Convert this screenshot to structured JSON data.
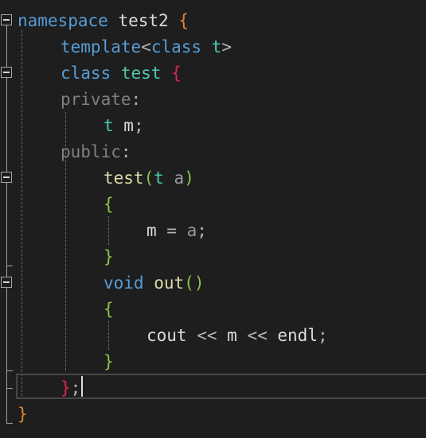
{
  "editor": {
    "theme": {
      "background": "#1e1e1e",
      "keyword": "#569cd6",
      "type": "#4ec9b0",
      "function": "#dcdcaa",
      "text": "#dcdcdc",
      "access": "#9b9b9b",
      "param": "#9cdcfe",
      "brace_orange": "#ffd700",
      "brace_pink": "#da70d6",
      "brace_green": "#6a9955",
      "punct": "#b4b4b4"
    },
    "lines": [
      {
        "indent": 0,
        "tokens": [
          {
            "t": "namespace",
            "c": "#569cd6"
          },
          {
            "t": " test2 ",
            "c": "#dcdcdc"
          },
          {
            "t": "{",
            "c": "#e2872e"
          }
        ]
      },
      {
        "indent": 4,
        "tokens": [
          {
            "t": "template",
            "c": "#569cd6"
          },
          {
            "t": "<",
            "c": "#b4b4b4"
          },
          {
            "t": "class",
            "c": "#569cd6"
          },
          {
            "t": " ",
            "c": "#dcdcdc"
          },
          {
            "t": "t",
            "c": "#4ec9b0"
          },
          {
            "t": ">",
            "c": "#b4b4b4"
          }
        ]
      },
      {
        "indent": 4,
        "tokens": [
          {
            "t": "class",
            "c": "#569cd6"
          },
          {
            "t": " ",
            "c": "#dcdcdc"
          },
          {
            "t": "test",
            "c": "#4ec9b0"
          },
          {
            "t": " ",
            "c": "#dcdcdc"
          },
          {
            "t": "{",
            "c": "#d9294f"
          }
        ]
      },
      {
        "indent": 4,
        "tokens": [
          {
            "t": "private",
            "c": "#808080"
          },
          {
            "t": ":",
            "c": "#b4b4b4"
          }
        ]
      },
      {
        "indent": 8,
        "tokens": [
          {
            "t": "t",
            "c": "#4ec9b0"
          },
          {
            "t": " m",
            "c": "#dcdcdc"
          },
          {
            "t": ";",
            "c": "#b4b4b4"
          }
        ]
      },
      {
        "indent": 4,
        "tokens": [
          {
            "t": "public",
            "c": "#808080"
          },
          {
            "t": ":",
            "c": "#b4b4b4"
          }
        ]
      },
      {
        "indent": 8,
        "tokens": [
          {
            "t": "test",
            "c": "#dcdcaa"
          },
          {
            "t": "(",
            "c": "#8bc34a"
          },
          {
            "t": "t",
            "c": "#4ec9b0"
          },
          {
            "t": " a",
            "c": "#9a9a9a"
          },
          {
            "t": ")",
            "c": "#8bc34a"
          }
        ]
      },
      {
        "indent": 8,
        "tokens": [
          {
            "t": "{",
            "c": "#8bc34a"
          }
        ]
      },
      {
        "indent": 12,
        "tokens": [
          {
            "t": "m",
            "c": "#dcdcdc"
          },
          {
            "t": " = ",
            "c": "#b4b4b4"
          },
          {
            "t": "a",
            "c": "#9a9a9a"
          },
          {
            "t": ";",
            "c": "#b4b4b4"
          }
        ]
      },
      {
        "indent": 8,
        "tokens": [
          {
            "t": "}",
            "c": "#8bc34a"
          }
        ]
      },
      {
        "indent": 8,
        "tokens": [
          {
            "t": "void",
            "c": "#569cd6"
          },
          {
            "t": " ",
            "c": "#dcdcdc"
          },
          {
            "t": "out",
            "c": "#dcdcaa"
          },
          {
            "t": "()",
            "c": "#8bc34a"
          }
        ]
      },
      {
        "indent": 8,
        "tokens": [
          {
            "t": "{",
            "c": "#8bc34a"
          }
        ]
      },
      {
        "indent": 12,
        "tokens": [
          {
            "t": "cout",
            "c": "#dcdcdc"
          },
          {
            "t": " << ",
            "c": "#b4b4b4"
          },
          {
            "t": "m",
            "c": "#dcdcdc"
          },
          {
            "t": " << ",
            "c": "#b4b4b4"
          },
          {
            "t": "endl",
            "c": "#dcdcdc"
          },
          {
            "t": ";",
            "c": "#b4b4b4"
          }
        ]
      },
      {
        "indent": 8,
        "tokens": [
          {
            "t": "}",
            "c": "#8bc34a"
          }
        ]
      },
      {
        "indent": 4,
        "tokens": [
          {
            "t": "}",
            "c": "#d9294f"
          },
          {
            "t": ";",
            "c": "#b4b4b4"
          }
        ]
      },
      {
        "indent": 0,
        "tokens": [
          {
            "t": "}",
            "c": "#e2872e"
          }
        ]
      }
    ]
  }
}
